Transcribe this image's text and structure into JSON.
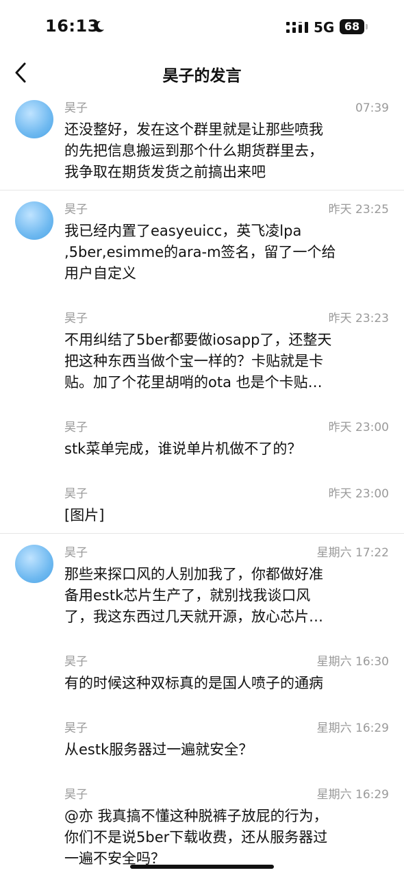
{
  "status_bar": {
    "time": "16:13",
    "network": "5G",
    "battery": "68"
  },
  "header": {
    "title": "昊子的发言"
  },
  "groups": [
    {
      "messages": [
        {
          "name": "昊子",
          "time": "07:39",
          "text": "还没整好，发在这个群里就是让那些喷我\n的先把信息搬运到那个什么期货群里去，\n我争取在期货发货之前搞出来吧"
        }
      ]
    },
    {
      "messages": [
        {
          "name": "昊子",
          "time": "昨天 23:25",
          "text": "我已经内置了easyeuicc，英飞凌lpa\n,5ber,esimme的ara-m签名，留了一个给\n用户自定义"
        },
        {
          "name": "昊子",
          "time": "昨天 23:23",
          "text": "不用纠结了5ber都要做iosapp了，还整天\n把这种东西当做个宝一样的？卡贴就是卡\n贴。加了个花里胡哨的ota 也是个卡贴…"
        },
        {
          "name": "昊子",
          "time": "昨天 23:00",
          "text": "stk菜单完成，谁说单片机做不了的？"
        },
        {
          "name": "昊子",
          "time": "昨天 23:00",
          "text": "[图片]"
        }
      ]
    },
    {
      "messages": [
        {
          "name": "昊子",
          "time": "星期六 17:22",
          "text": "那些来探口风的人别加我了，你都做好准\n备用estk芯片生产了，就别找我谈口风\n了，我这东西过几天就开源，放心芯片…"
        },
        {
          "name": "昊子",
          "time": "星期六 16:30",
          "text": "有的时候这种双标真的是国人喷子的通病"
        },
        {
          "name": "昊子",
          "time": "星期六 16:29",
          "text": "从estk服务器过一遍就安全？"
        },
        {
          "name": "昊子",
          "time": "星期六 16:29",
          "text": "@亦 我真搞不懂这种脱裤子放屁的行为，\n你们不是说5ber下载收费，还从服务器过\n一遍不安全吗？"
        }
      ]
    }
  ]
}
